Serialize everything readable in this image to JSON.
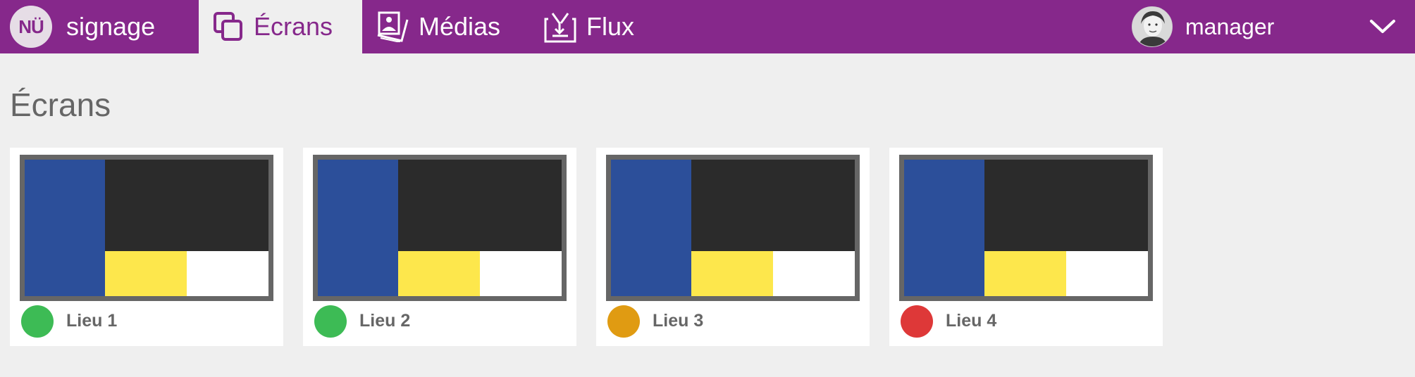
{
  "header": {
    "logo_text": "NÜ",
    "brand": "signage",
    "tabs": [
      {
        "label": "Écrans",
        "icon": "screens-icon",
        "active": true
      },
      {
        "label": "Médias",
        "icon": "media-icon",
        "active": false
      },
      {
        "label": "Flux",
        "icon": "feed-icon",
        "active": false
      }
    ],
    "user": {
      "name": "manager",
      "avatar": "user-avatar"
    },
    "dropdown_icon": "chevron-down-icon"
  },
  "page": {
    "title": "Écrans"
  },
  "screen_colors": {
    "left": "#2c4f9a",
    "top": "#2b2b2b",
    "bottom_left": "#fde74c",
    "bottom_right": "#ffffff"
  },
  "screens": [
    {
      "label": "Lieu 1",
      "status": "online",
      "status_color": "#3dbb55"
    },
    {
      "label": "Lieu 2",
      "status": "online",
      "status_color": "#3dbb55"
    },
    {
      "label": "Lieu 3",
      "status": "warning",
      "status_color": "#e09b12"
    },
    {
      "label": "Lieu 4",
      "status": "offline",
      "status_color": "#de3838"
    }
  ],
  "colors": {
    "accent": "#86288b",
    "background": "#efefef",
    "text": "#666666"
  }
}
